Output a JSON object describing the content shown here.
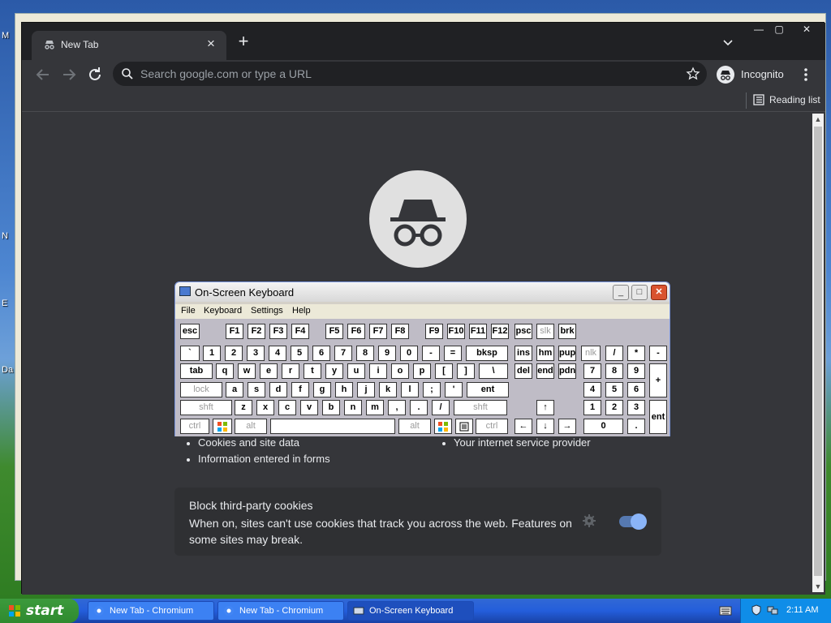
{
  "desktop": {
    "labels": [
      "M",
      "N",
      "E",
      "Da"
    ]
  },
  "browser": {
    "tab_title": "New Tab",
    "omnibox_placeholder": "Search google.com or type a URL",
    "incognito_label": "Incognito",
    "reading_list_label": "Reading list",
    "page": {
      "list_left": [
        "Cookies and site data",
        "Information entered in forms"
      ],
      "list_right": [
        "Your internet service provider"
      ],
      "cookie_card": {
        "title": "Block third-party cookies",
        "description": "When on, sites can't use cookies that track you across the web. Features on some sites may break.",
        "toggle_on": true
      }
    }
  },
  "osk": {
    "title": "On-Screen Keyboard",
    "menu": [
      "File",
      "Keyboard",
      "Settings",
      "Help"
    ],
    "keys": {
      "row0": [
        "esc",
        "F1",
        "F2",
        "F3",
        "F4",
        "F5",
        "F6",
        "F7",
        "F8",
        "F9",
        "F10",
        "F11",
        "F12",
        "psc",
        "slk",
        "brk"
      ],
      "row1": [
        "`",
        "1",
        "2",
        "3",
        "4",
        "5",
        "6",
        "7",
        "8",
        "9",
        "0",
        "-",
        "=",
        "bksp",
        "ins",
        "hm",
        "pup",
        "nlk",
        "/",
        "*",
        "-"
      ],
      "row2": [
        "tab",
        "q",
        "w",
        "e",
        "r",
        "t",
        "y",
        "u",
        "i",
        "o",
        "p",
        "[",
        "]",
        "\\",
        "del",
        "end",
        "pdn",
        "7",
        "8",
        "9",
        "+"
      ],
      "row3": [
        "lock",
        "a",
        "s",
        "d",
        "f",
        "g",
        "h",
        "j",
        "k",
        "l",
        ";",
        "'",
        "ent",
        "4",
        "5",
        "6"
      ],
      "row4": [
        "shft",
        "z",
        "x",
        "c",
        "v",
        "b",
        "n",
        "m",
        ",",
        ".",
        "/",
        "shft",
        "1",
        "2",
        "3",
        "ent"
      ],
      "row5": [
        "ctrl",
        "alt",
        "alt",
        "ctrl",
        "0",
        "."
      ]
    }
  },
  "taskbar": {
    "start_label": "start",
    "buttons": [
      "New Tab - Chromium",
      "New Tab - Chromium",
      "On-Screen Keyboard"
    ],
    "clock": "2:11 AM"
  }
}
